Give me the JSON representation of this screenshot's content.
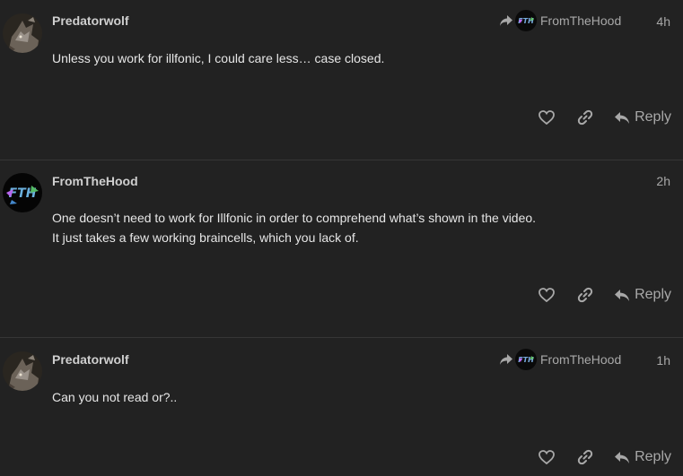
{
  "posts": [
    {
      "username": "Predatorwolf",
      "avatar_icon": "wolf-avatar-icon",
      "reply_to": "FromTheHood",
      "time": "4h",
      "lines": [
        "Unless you work for illfonic, I could care less… case closed."
      ],
      "reply_label": "Reply"
    },
    {
      "username": "FromTheHood",
      "avatar_icon": "fth-logo-avatar-icon",
      "reply_to": null,
      "time": "2h",
      "lines": [
        "One doesn’t need to work for Illfonic in order to comprehend what’s shown in the video.",
        "It just takes a few working braincells, which you lack of."
      ],
      "reply_label": "Reply"
    },
    {
      "username": "Predatorwolf",
      "avatar_icon": "wolf-avatar-icon",
      "reply_to": "FromTheHood",
      "time": "1h",
      "lines": [
        "Can you not read or?.."
      ],
      "reply_label": "Reply"
    }
  ],
  "icons": {
    "like": "heart-icon",
    "link": "link-icon",
    "reply": "reply-arrow-icon",
    "reply_to": "share-arrow-icon"
  },
  "colors": {
    "background": "#222222",
    "text": "#e6e6e6",
    "muted": "#a8a8a8",
    "divider": "#363636"
  }
}
